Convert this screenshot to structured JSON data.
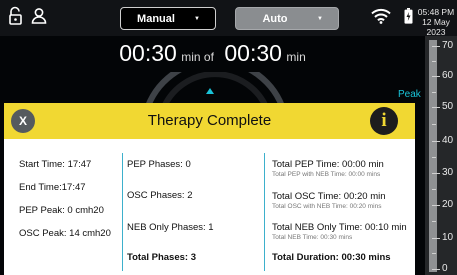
{
  "topbar": {
    "mode_manual": "Manual",
    "mode_auto": "Auto",
    "active_mode": "Auto",
    "clock_time": "05:48 PM",
    "clock_date": "12 May 2023"
  },
  "timer": {
    "elapsed": "00:30",
    "elapsed_unit": "min of",
    "total": "00:30",
    "total_unit": "min"
  },
  "peak_label": "Peak",
  "scale": {
    "labels": [
      "70",
      "60",
      "50",
      "40",
      "30",
      "20",
      "10",
      "0"
    ]
  },
  "dialog": {
    "title": "Therapy Complete",
    "close_label": "X",
    "info_label": "i",
    "col1": {
      "start_time": "Start Time: 17:47",
      "end_time": "End Time:17:47",
      "pep_peak": "PEP Peak: 0 cmh20",
      "osc_peak": "OSC Peak: 14 cmh20"
    },
    "col2": {
      "pep_phases": "PEP Phases: 0",
      "osc_phases": "OSC Phases: 2",
      "neb_phases": "NEB Only Phases: 1",
      "total_phases": "Total Phases: 3"
    },
    "col3": {
      "total_pep": "Total PEP Time: 00:00 min",
      "total_pep_sub": "Total PEP with NEB Time: 00:00 mins",
      "total_osc": "Total OSC Time: 00:20 min",
      "total_osc_sub": "Total OSC with NEB Time: 00:20 mins",
      "total_neb": "Total NEB Only Time: 00:10 min",
      "total_neb_sub": "Total NEB Time: 00:30 mins",
      "total_duration": "Total Duration: 00:30 mins"
    }
  },
  "colors": {
    "header_yellow": "#f1d832",
    "divider_teal": "#3db0cc",
    "peak_cyan": "#19c3d8",
    "auto_gray": "#8a8d90"
  }
}
